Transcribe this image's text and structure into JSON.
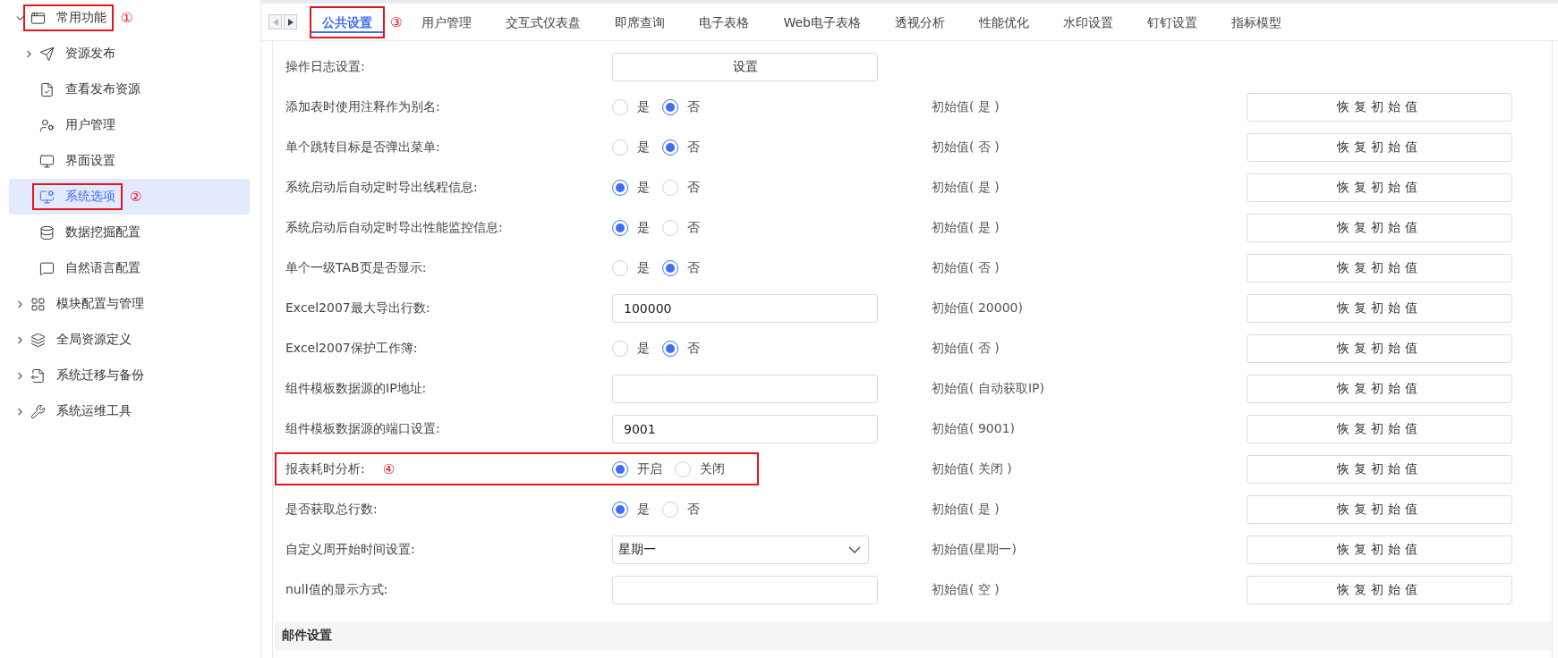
{
  "sidebar": {
    "items": [
      {
        "label": "常用功能",
        "kind": "group",
        "expanded": true,
        "selected": false,
        "callout": "①",
        "children": [
          {
            "label": "资源发布",
            "kind": "group",
            "expanded": false,
            "selected": false
          },
          {
            "label": "查看发布资源",
            "kind": "leaf",
            "selected": false
          },
          {
            "label": "用户管理",
            "kind": "leaf",
            "selected": false
          },
          {
            "label": "界面设置",
            "kind": "leaf",
            "selected": false
          },
          {
            "label": "系统选项",
            "kind": "leaf",
            "selected": true,
            "callout": "②"
          },
          {
            "label": "数据挖掘配置",
            "kind": "leaf",
            "selected": false
          },
          {
            "label": "自然语言配置",
            "kind": "leaf",
            "selected": false
          }
        ]
      },
      {
        "label": "模块配置与管理",
        "kind": "group",
        "expanded": false,
        "selected": false
      },
      {
        "label": "全局资源定义",
        "kind": "group",
        "expanded": false,
        "selected": false
      },
      {
        "label": "系统迁移与备份",
        "kind": "group",
        "expanded": false,
        "selected": false
      },
      {
        "label": "系统运维工具",
        "kind": "group",
        "expanded": false,
        "selected": false
      }
    ]
  },
  "tabs": [
    {
      "label": "公共设置",
      "selected": true,
      "callout": "③"
    },
    {
      "label": "用户管理",
      "selected": false
    },
    {
      "label": "交互式仪表盘",
      "selected": false
    },
    {
      "label": "即席查询",
      "selected": false
    },
    {
      "label": "电子表格",
      "selected": false
    },
    {
      "label": "Web电子表格",
      "selected": false
    },
    {
      "label": "透视分析",
      "selected": false
    },
    {
      "label": "性能优化",
      "selected": false
    },
    {
      "label": "水印设置",
      "selected": false
    },
    {
      "label": "钉钉设置",
      "selected": false
    },
    {
      "label": "指标模型",
      "selected": false
    }
  ],
  "settings": [
    {
      "label": "操作日志设置:",
      "kind": "button",
      "button_label": "设置"
    },
    {
      "label": "添加表时使用注释作为别名:",
      "kind": "radio",
      "options": [
        {
          "label": "是",
          "selected": false
        },
        {
          "label": "否",
          "selected": true
        }
      ],
      "initial": "初始值( 是 )",
      "restore_label": "恢复初始值"
    },
    {
      "label": "单个跳转目标是否弹出菜单:",
      "kind": "radio",
      "options": [
        {
          "label": "是",
          "selected": false
        },
        {
          "label": "否",
          "selected": true
        }
      ],
      "initial": "初始值( 否 )",
      "restore_label": "恢复初始值"
    },
    {
      "label": "系统启动后自动定时导出线程信息:",
      "kind": "radio",
      "options": [
        {
          "label": "是",
          "selected": true
        },
        {
          "label": "否",
          "selected": false
        }
      ],
      "initial": "初始值( 是 )",
      "restore_label": "恢复初始值"
    },
    {
      "label": "系统启动后自动定时导出性能监控信息:",
      "kind": "radio",
      "options": [
        {
          "label": "是",
          "selected": true
        },
        {
          "label": "否",
          "selected": false
        }
      ],
      "initial": "初始值( 是 )",
      "restore_label": "恢复初始值"
    },
    {
      "label": "单个一级TAB页是否显示:",
      "kind": "radio",
      "options": [
        {
          "label": "是",
          "selected": false
        },
        {
          "label": "否",
          "selected": true
        }
      ],
      "initial": "初始值( 否 )",
      "restore_label": "恢复初始值"
    },
    {
      "label": "Excel2007最大导出行数:",
      "kind": "input",
      "value": "100000",
      "initial": "初始值( 20000)",
      "restore_label": "恢复初始值"
    },
    {
      "label": "Excel2007保护工作簿:",
      "kind": "radio",
      "options": [
        {
          "label": "是",
          "selected": false
        },
        {
          "label": "否",
          "selected": true
        }
      ],
      "initial": "初始值( 否 )",
      "restore_label": "恢复初始值"
    },
    {
      "label": "组件模板数据源的IP地址:",
      "kind": "input",
      "initial": "初始值( 自动获取IP)",
      "restore_label": "恢复初始值"
    },
    {
      "label": "组件模板数据源的端口设置:",
      "kind": "input",
      "value": "9001",
      "initial": "初始值( 9001)",
      "restore_label": "恢复初始值"
    },
    {
      "label": "报表耗时分析:",
      "kind": "radio",
      "callout": "④",
      "options": [
        {
          "label": "开启",
          "selected": true
        },
        {
          "label": "关闭",
          "selected": false
        }
      ],
      "initial": "初始值( 关闭 )",
      "restore_label": "恢复初始值"
    },
    {
      "label": "是否获取总行数:",
      "kind": "radio",
      "options": [
        {
          "label": "是",
          "selected": true
        },
        {
          "label": "否",
          "selected": false
        }
      ],
      "initial": "初始值( 是 )",
      "restore_label": "恢复初始值"
    },
    {
      "label": "自定义周开始时间设置:",
      "kind": "select",
      "value": "星期一",
      "initial": "初始值(星期一)",
      "restore_label": "恢复初始值"
    },
    {
      "label": "null值的显示方式:",
      "kind": "input",
      "initial": "初始值( 空 )",
      "restore_label": "恢复初始值"
    }
  ],
  "section": {
    "title": "邮件设置"
  }
}
